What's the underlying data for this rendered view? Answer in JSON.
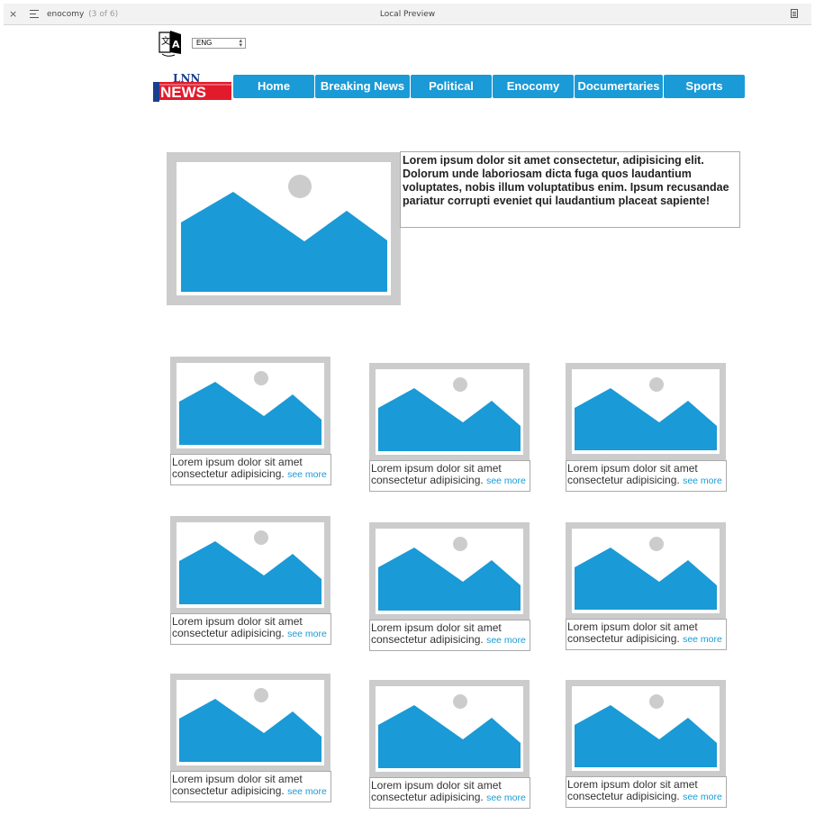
{
  "chrome": {
    "close_glyph": "×",
    "document_name": "enocomy",
    "document_count": "(3 of 6)",
    "title": "Local Preview"
  },
  "language": {
    "selected": "ENG",
    "icon": "translate-icon"
  },
  "logo": {
    "top_text": "LNN",
    "bottom_text": "NEWS",
    "colors": {
      "red": "#e21b2c",
      "blue": "#1a3f8f"
    }
  },
  "nav": {
    "items": [
      {
        "label": "Home"
      },
      {
        "label": "Breaking News"
      },
      {
        "label": "Political"
      },
      {
        "label": "Enocomy"
      },
      {
        "label": "Documertaries"
      },
      {
        "label": "Sports"
      }
    ]
  },
  "hero": {
    "text": "Lorem ipsum dolor sit amet consectetur, adipisicing elit. Dolorum unde laboriosam dicta fuga quos laudantium voluptates, nobis illum voluptatibus enim. Ipsum recusandae pariatur corrupti eveniet qui laudantium placeat sapiente!"
  },
  "cards": [
    {
      "text": "Lorem ipsum dolor sit amet consectetur adipisicing.",
      "more": "see more"
    },
    {
      "text": "Lorem ipsum dolor sit amet consectetur adipisicing.",
      "more": "see more"
    },
    {
      "text": "Lorem ipsum dolor sit amet consectetur adipisicing.",
      "more": "see more"
    },
    {
      "text": "Lorem ipsum dolor sit amet consectetur adipisicing.",
      "more": "see more"
    },
    {
      "text": "Lorem ipsum dolor sit amet consectetur adipisicing.",
      "more": "see more"
    },
    {
      "text": "Lorem ipsum dolor sit amet consectetur adipisicing.",
      "more": "see more"
    },
    {
      "text": "Lorem ipsum dolor sit amet consectetur adipisicing.",
      "more": "see more"
    },
    {
      "text": "Lorem ipsum dolor sit amet consectetur adipisicing.",
      "more": "see more"
    },
    {
      "text": "Lorem ipsum dolor sit amet consectetur adipisicing.",
      "more": "see more"
    }
  ],
  "colors": {
    "accent": "#1a9ad6",
    "placeholder_frame": "#cccccc",
    "placeholder_sun": "#cccccc"
  },
  "icons": {
    "placeholder": "image-placeholder-icon",
    "close": "close-icon",
    "menu": "menu-icon",
    "reader": "reader-icon"
  }
}
